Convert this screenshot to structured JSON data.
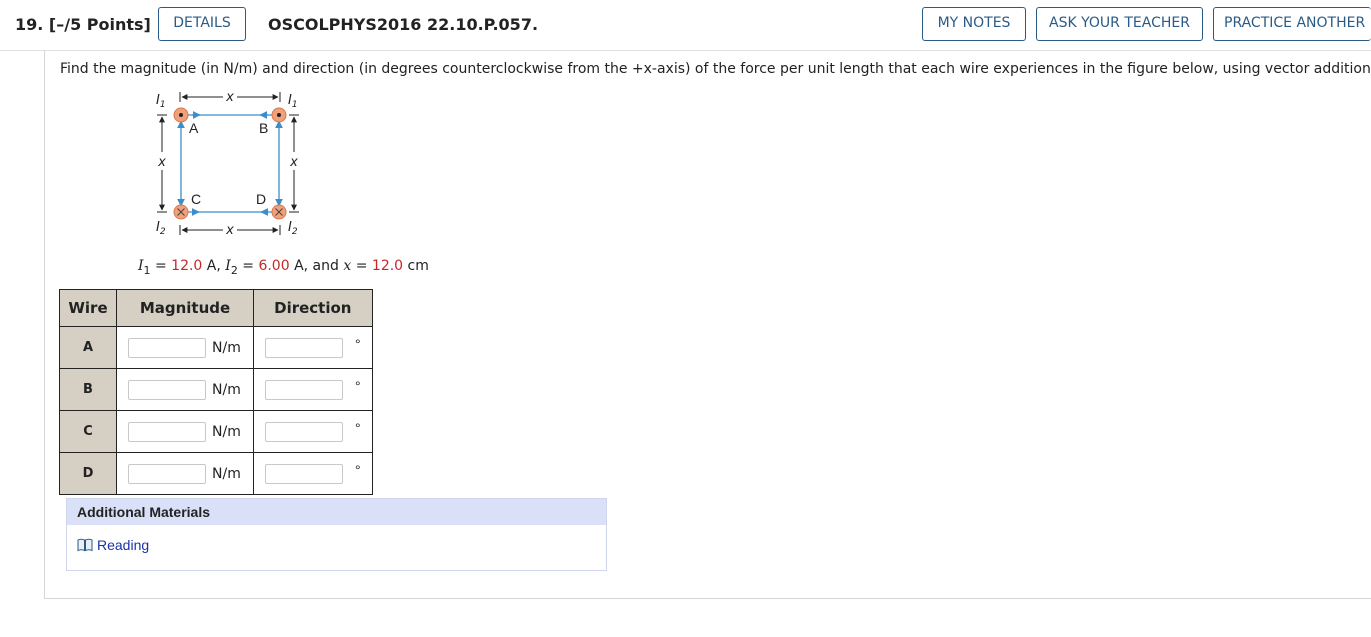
{
  "header": {
    "question_number": "19.",
    "points": "[–/5 Points]",
    "details_label": "DETAILS",
    "question_code": "OSCOLPHYS2016 22.10.P.057.",
    "my_notes_label": "MY NOTES",
    "ask_teacher_label": "ASK YOUR TEACHER",
    "practice_another_label": "PRACTICE ANOTHER"
  },
  "prompt": "Find the magnitude (in N/m) and direction (in degrees counterclockwise from the +x-axis) of the force per unit length that each wire experiences in the figure below, using vector addition.",
  "figure": {
    "labels": {
      "top_left_current": "I",
      "top_left_sub": "1",
      "top_right_current": "I",
      "top_right_sub": "1",
      "bottom_left_current": "I",
      "bottom_left_sub": "2",
      "bottom_right_current": "I",
      "bottom_right_sub": "2",
      "wire_a": "A",
      "wire_b": "B",
      "wire_c": "C",
      "wire_d": "D",
      "spacing": "x"
    },
    "colors": {
      "wire_fill": "#f0a07a",
      "arrow": "#3b8ec9"
    }
  },
  "givens": {
    "i1_symbol": "I",
    "i1_sub": "1",
    "i1_value": "12.0",
    "i1_unit": "A,",
    "i2_symbol": "I",
    "i2_sub": "2",
    "i2_value": "6.00",
    "i2_unit": "A, and",
    "x_symbol": "x",
    "x_value": "12.0",
    "x_unit": "cm"
  },
  "table": {
    "headers": [
      "Wire",
      "Magnitude",
      "Direction"
    ],
    "rows": [
      {
        "wire": "A",
        "magnitude_value": "",
        "unit": "N/m",
        "direction_value": "",
        "deg": "°"
      },
      {
        "wire": "B",
        "magnitude_value": "",
        "unit": "N/m",
        "direction_value": "",
        "deg": "°"
      },
      {
        "wire": "C",
        "magnitude_value": "",
        "unit": "N/m",
        "direction_value": "",
        "deg": "°"
      },
      {
        "wire": "D",
        "magnitude_value": "",
        "unit": "N/m",
        "direction_value": "",
        "deg": "°"
      }
    ]
  },
  "additional_materials": {
    "title": "Additional Materials",
    "link_label": "Reading",
    "link_icon": "book-icon"
  },
  "colors": {
    "button_border": "#2a5b87",
    "given_value": "#c62828",
    "link": "#1a33a8",
    "table_header_bg": "#d6cfc4",
    "materials_header_bg": "#d9e0f7"
  }
}
